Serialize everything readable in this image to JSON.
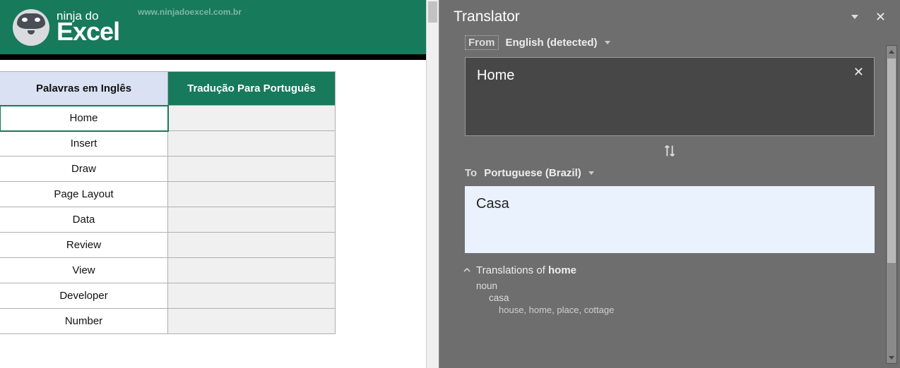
{
  "banner": {
    "logo_top": "ninja do",
    "logo_bottom": "Excel",
    "url": "www.ninjadoexcel.com.br"
  },
  "table": {
    "header_c1": "Palavras em Inglês",
    "header_c2": "Tradução Para Português",
    "rows": [
      {
        "en": "Home",
        "pt": ""
      },
      {
        "en": "Insert",
        "pt": ""
      },
      {
        "en": "Draw",
        "pt": ""
      },
      {
        "en": "Page Layout",
        "pt": ""
      },
      {
        "en": "Data",
        "pt": ""
      },
      {
        "en": "Review",
        "pt": ""
      },
      {
        "en": "View",
        "pt": ""
      },
      {
        "en": "Developer",
        "pt": ""
      },
      {
        "en": "Number",
        "pt": ""
      }
    ],
    "selected_row": 0
  },
  "translator": {
    "title": "Translator",
    "from_label": "From",
    "from_lang": "English (detected)",
    "input_text": "Home",
    "to_label": "To",
    "to_lang": "Portuguese (Brazil)",
    "output_text": "Casa",
    "translations_heading_prefix": "Translations of ",
    "translations_heading_word": "home",
    "pos": "noun",
    "primary_translation": "casa",
    "alternatives": "house, home, place, cottage"
  }
}
